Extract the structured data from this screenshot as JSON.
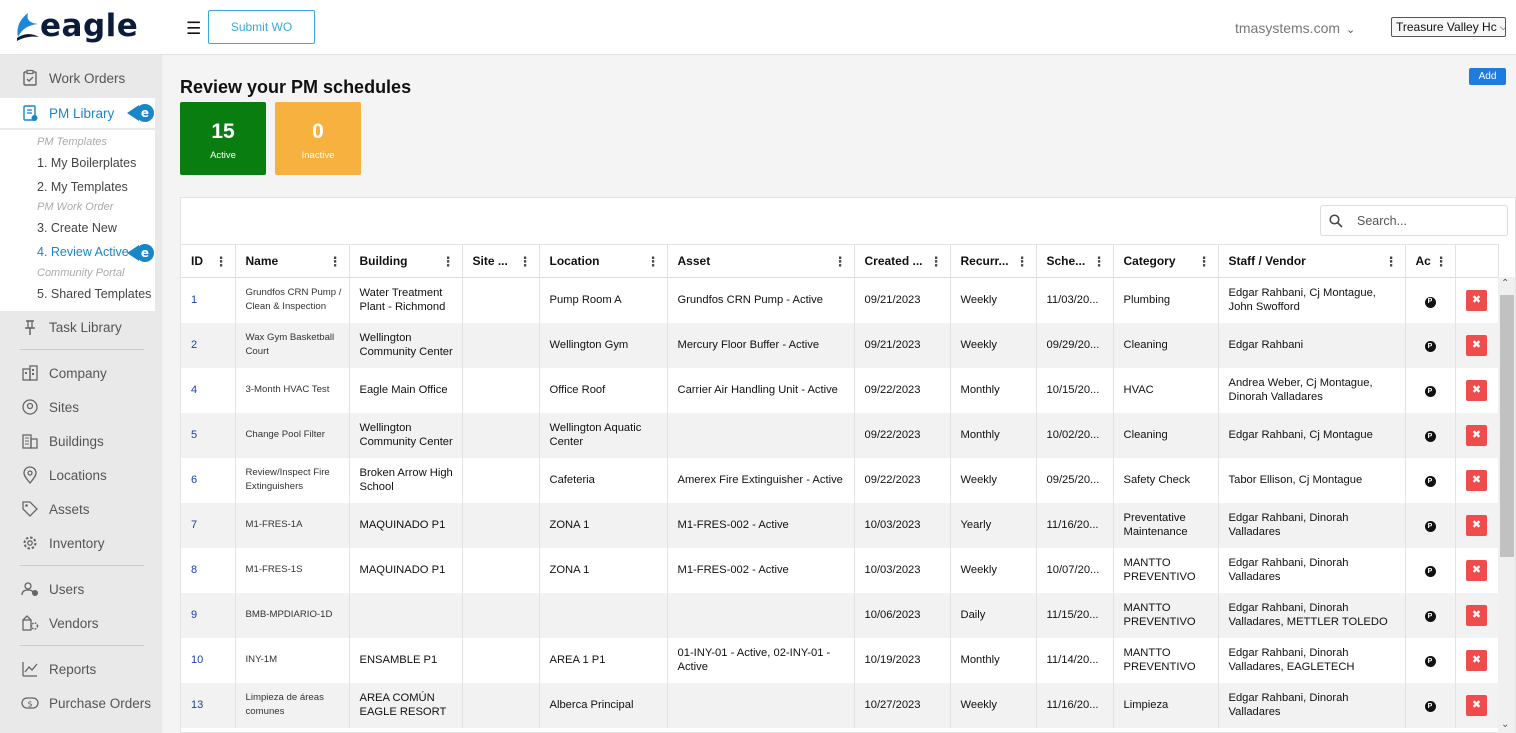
{
  "header": {
    "logo_text": "eagle",
    "submit_wo_label": "Submit WO",
    "domain": "tmasystems.com",
    "org_selected": "Treasure Valley Hc"
  },
  "sidebar": {
    "items": [
      {
        "label": "Work Orders",
        "icon": "clipboard-check-icon"
      },
      {
        "label": "PM Library",
        "icon": "pm-library-icon"
      },
      {
        "label": "Task Library",
        "icon": "pin-icon"
      },
      {
        "label": "Company",
        "icon": "company-icon"
      },
      {
        "label": "Sites",
        "icon": "sites-icon"
      },
      {
        "label": "Buildings",
        "icon": "building-icon"
      },
      {
        "label": "Locations",
        "icon": "location-pin-icon"
      },
      {
        "label": "Assets",
        "icon": "tag-icon"
      },
      {
        "label": "Inventory",
        "icon": "gear-icon"
      },
      {
        "label": "Users",
        "icon": "users-icon"
      },
      {
        "label": "Vendors",
        "icon": "vendors-icon"
      },
      {
        "label": "Reports",
        "icon": "reports-icon"
      },
      {
        "label": "Purchase Orders",
        "icon": "dollar-icon"
      }
    ],
    "pm_templates_heading": "PM Templates",
    "my_boilerplates": "1. My Boilerplates",
    "my_templates": "2. My Templates",
    "pm_work_order_heading": "PM Work Order",
    "create_new": "3. Create New",
    "review_active": "4. Review Active",
    "community_portal": "Community Portal",
    "shared_templates": "5. Shared Templates",
    "badge_letter": "e"
  },
  "main": {
    "title": "Review your PM schedules",
    "add_label": "Add",
    "stats": {
      "active_count": "15",
      "active_label": "Active",
      "inactive_count": "0",
      "inactive_label": "Inactive"
    },
    "search_placeholder": "Search...",
    "columns": [
      "ID",
      "Name",
      "Building",
      "Site ...",
      "Location",
      "Asset",
      "Created ...",
      "Recurr...",
      "Sche...",
      "Category",
      "Staff / Vendor",
      "Ac"
    ],
    "rows": [
      {
        "id": "1",
        "name": "Grundfos CRN Pump / Clean & Inspection",
        "building": "Water Treatment Plant - Richmond",
        "site": "",
        "location": "Pump Room A",
        "asset": "Grundfos CRN Pump - Active",
        "created": "09/21/2023",
        "recurrence": "Weekly",
        "schedule": "11/03/20...",
        "category": "Plumbing",
        "staff": "Edgar Rahbani, Cj Montague, John Swofford"
      },
      {
        "id": "2",
        "name": "Wax Gym Basketball Court",
        "building": "Wellington Community Center",
        "site": "",
        "location": "Wellington Gym",
        "asset": "Mercury Floor Buffer - Active",
        "created": "09/21/2023",
        "recurrence": "Weekly",
        "schedule": "09/29/20...",
        "category": "Cleaning",
        "staff": "Edgar Rahbani"
      },
      {
        "id": "4",
        "name": "3-Month HVAC Test",
        "building": "Eagle Main Office",
        "site": "",
        "location": "Office Roof",
        "asset": "Carrier Air Handling Unit - Active",
        "created": "09/22/2023",
        "recurrence": "Monthly",
        "schedule": "10/15/20...",
        "category": "HVAC",
        "staff": "Andrea Weber, Cj Montague, Dinorah Valladares"
      },
      {
        "id": "5",
        "name": "Change Pool Filter",
        "building": "Wellington Community Center",
        "site": "",
        "location": "Wellington Aquatic Center",
        "asset": "",
        "created": "09/22/2023",
        "recurrence": "Monthly",
        "schedule": "10/02/20...",
        "category": "Cleaning",
        "staff": "Edgar Rahbani, Cj Montague"
      },
      {
        "id": "6",
        "name": "Review/Inspect Fire Extinguishers",
        "building": "Broken Arrow High School",
        "site": "",
        "location": "Cafeteria",
        "asset": "Amerex Fire Extinguisher - Active",
        "created": "09/22/2023",
        "recurrence": "Weekly",
        "schedule": "09/25/20...",
        "category": "Safety Check",
        "staff": "Tabor Ellison, Cj Montague"
      },
      {
        "id": "7",
        "name": "M1-FRES-1A",
        "building": "MAQUINADO P1",
        "site": "",
        "location": "ZONA 1",
        "asset": "M1-FRES-002 - Active",
        "created": "10/03/2023",
        "recurrence": "Yearly",
        "schedule": "11/16/20...",
        "category": "Preventative Maintenance",
        "staff": "Edgar Rahbani, Dinorah Valladares"
      },
      {
        "id": "8",
        "name": "M1-FRES-1S",
        "building": "MAQUINADO P1",
        "site": "",
        "location": "ZONA 1",
        "asset": "M1-FRES-002 - Active",
        "created": "10/03/2023",
        "recurrence": "Weekly",
        "schedule": "10/07/20...",
        "category": "MANTTO PREVENTIVO",
        "staff": "Edgar Rahbani, Dinorah Valladares"
      },
      {
        "id": "9",
        "name": "BMB-MPDIARIO-1D",
        "building": "",
        "site": "",
        "location": "",
        "asset": "",
        "created": "10/06/2023",
        "recurrence": "Daily",
        "schedule": "11/15/20...",
        "category": "MANTTO PREVENTIVO",
        "staff": "Edgar Rahbani, Dinorah Valladares, METTLER TOLEDO"
      },
      {
        "id": "10",
        "name": "INY-1M",
        "building": "ENSAMBLE P1",
        "site": "",
        "location": "AREA 1 P1",
        "asset": "01-INY-01 - Active, 02-INY-01 - Active",
        "created": "10/19/2023",
        "recurrence": "Monthly",
        "schedule": "11/14/20...",
        "category": "MANTTO PREVENTIVO",
        "staff": "Edgar Rahbani, Dinorah Valladares, EAGLETECH"
      },
      {
        "id": "13",
        "name": "Limpieza de áreas comunes",
        "building": "AREA COMÚN EAGLE RESORT",
        "site": "",
        "location": "Alberca Principal",
        "asset": "",
        "created": "10/27/2023",
        "recurrence": "Weekly",
        "schedule": "11/16/20...",
        "category": "Limpieza",
        "staff": "Edgar Rahbani, Dinorah Valladares"
      }
    ],
    "action_icon_letter": "P",
    "delete_icon": "✖"
  },
  "colors": {
    "accent": "#1a86c7",
    "active_stat": "#0a7d10",
    "inactive_stat": "#f7b13e",
    "delete": "#f04c4c",
    "add_button": "#1e7be0"
  }
}
